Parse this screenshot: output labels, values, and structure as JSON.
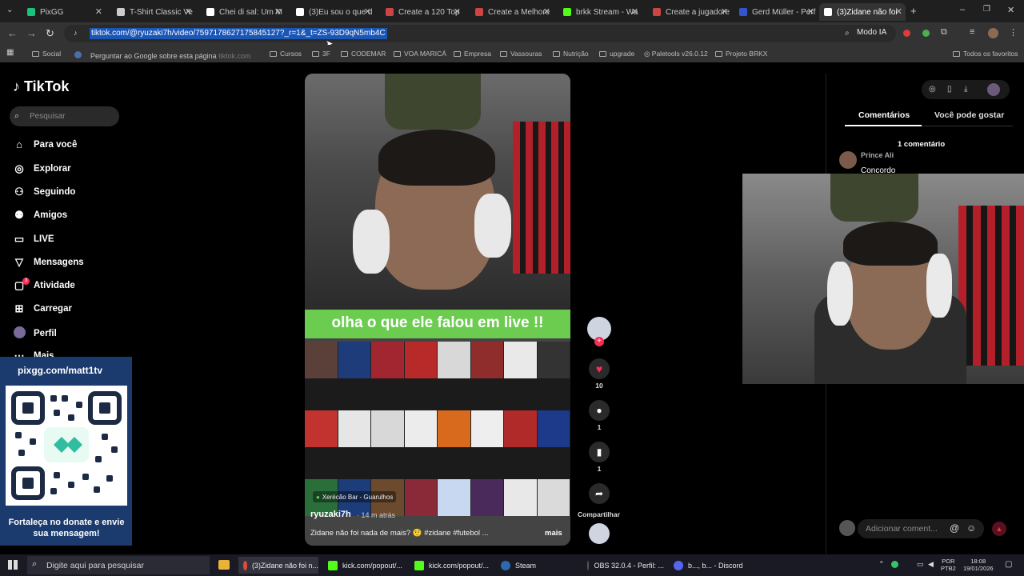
{
  "browser": {
    "tabs": [
      {
        "label": "PixGG",
        "color": "#19c37d"
      },
      {
        "label": "T-Shirt Classic Ve",
        "color": "#cccccc"
      },
      {
        "label": "Chei di sal: Um M",
        "color": "#ffffff"
      },
      {
        "label": "(3)Eu sou o que d",
        "color": "#ffffff"
      },
      {
        "label": "Create a 120 Top",
        "color": "#cc4444"
      },
      {
        "label": "Create a Melhore",
        "color": "#cc4444"
      },
      {
        "label": "brkk Stream - Wa",
        "color": "#53fc18"
      },
      {
        "label": "Create a jugadore",
        "color": "#cc4444"
      },
      {
        "label": "Gerd Müller - Perf",
        "color": "#3355cc"
      },
      {
        "label": "(3)Zidane não foi",
        "color": "#ffffff"
      }
    ],
    "url": "tiktok.com/@ryuzaki7h/video/7597178627175845127?_r=1&_t=ZS-93D9qN5mb4C",
    "suggestion": "Perguntar ao Google sobre esta página",
    "suggestion_domain": "tiktok.com",
    "modo_ia": "Modo IA",
    "bookmarks": [
      "Social",
      "Cursos",
      "3F",
      "CODEMAR",
      "VOA MARICÁ",
      "Empresa",
      "Vassouras",
      "Nutrição",
      "upgrade",
      "Paletools v26.0.12",
      "Projeto BRKX"
    ],
    "bookmarks_all": "Todos os favoritos"
  },
  "tiktok": {
    "logo": "TikTok",
    "search_placeholder": "Pesquisar",
    "nav": [
      "Para você",
      "Explorar",
      "Seguindo",
      "Amigos",
      "LIVE",
      "Mensagens",
      "Atividade",
      "Carregar",
      "Perfil",
      "Mais"
    ],
    "activity_badge": "3"
  },
  "promo": {
    "url": "pixgg.com/matt1tv",
    "message": "Fortaleça no donate e envie sua mensagem!"
  },
  "video": {
    "caption": "olha o que ele falou em live !!",
    "location": "Xerécão Bar - Guarulhos",
    "author": "ryuzaki7h",
    "time": "· 14 m atrás",
    "description": "Zidane não foi nada de mais? 🤨 #zidane #futebol ...",
    "more": "mais",
    "likes": "10",
    "comments": "1",
    "saves": "1",
    "share": "Compartilhar"
  },
  "comments_panel": {
    "tab_comments": "Comentários",
    "tab_suggest": "Você pode gostar",
    "count": "1 comentário",
    "commenter": "Prince Ali",
    "text": "Concordo",
    "input_placeholder": "Adicionar coment..."
  },
  "taskbar": {
    "search": "Digite aqui para pesquisar",
    "apps": [
      "(3)Zidane não foi n...",
      "kick.com/popout/...",
      "kick.com/popout/...",
      "Steam",
      "OBS 32.0.4 - Perfil: ...",
      "b..., b... - Discord"
    ],
    "lang_top": "POR",
    "lang_bottom": "PTB2",
    "time": "18:08",
    "date": "19/01/2026"
  }
}
